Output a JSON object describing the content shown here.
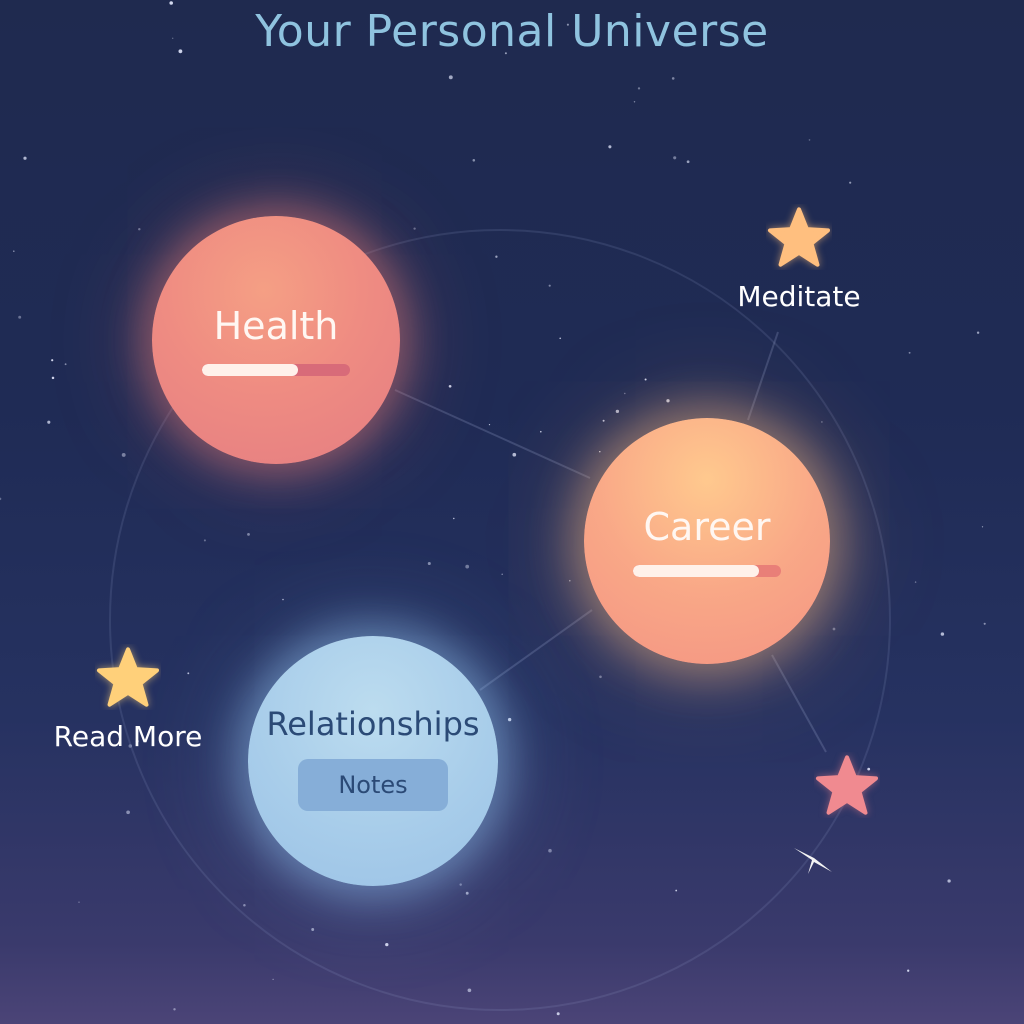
{
  "title": "Your Personal Universe",
  "planets": {
    "health": {
      "label": "Health",
      "progress": 0.65,
      "color": "#ef8c82"
    },
    "career": {
      "label": "Career",
      "progress": 0.85,
      "color": "#f9a887"
    },
    "relationships": {
      "label": "Relationships",
      "button_label": "Notes",
      "color": "#a8cdea"
    }
  },
  "stars": {
    "meditate": {
      "label": "Meditate",
      "icon": "star-icon",
      "color": "#ffbf7f"
    },
    "read_more": {
      "label": "Read More",
      "icon": "star-icon",
      "color": "#ffd07a"
    },
    "pink": {
      "icon": "star-icon",
      "color": "#f08a90"
    },
    "sparkle": {
      "icon": "sparkle-icon",
      "color": "#f4f4f4"
    }
  },
  "colors": {
    "background_top": "#1f2a4f",
    "background_bottom": "#4b4477",
    "title": "#8fc3df"
  }
}
